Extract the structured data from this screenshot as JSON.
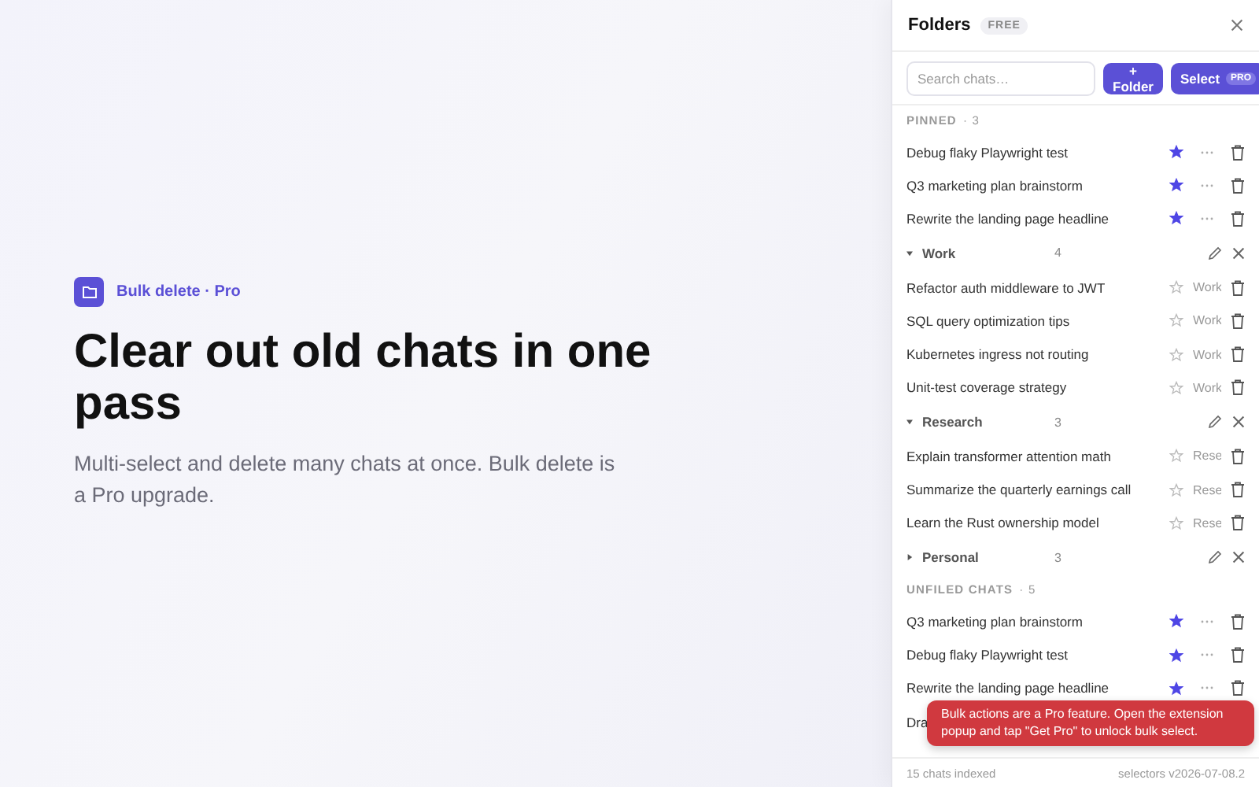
{
  "hero": {
    "badge": "Bulk delete · Pro",
    "title": "Clear out old chats in one pass",
    "subtitle": "Multi-select and delete many chats at once. Bulk delete is a Pro upgrade."
  },
  "panel": {
    "title": "Folders",
    "plan": "FREE",
    "search": {
      "placeholder": "Search chats…"
    },
    "folder_button": "+ Folder",
    "select_button": "Select",
    "select_badge": "PRO",
    "items": [
      {
        "kind": "section",
        "label": "PINNED",
        "count": "· 3"
      },
      {
        "kind": "chat",
        "title": "Debug flaky Playwright test",
        "starred": true
      },
      {
        "kind": "chat",
        "title": "Q3 marketing plan brainstorm",
        "starred": true
      },
      {
        "kind": "chat",
        "title": "Rewrite the landing page headline",
        "starred": true
      },
      {
        "kind": "folder",
        "name": "Work",
        "count": "4",
        "expanded": true
      },
      {
        "kind": "chat",
        "title": "Refactor auth middleware to JWT",
        "starred": false,
        "tag": "Work"
      },
      {
        "kind": "chat",
        "title": "SQL query optimization tips",
        "starred": false,
        "tag": "Work"
      },
      {
        "kind": "chat",
        "title": "Kubernetes ingress not routing",
        "starred": false,
        "tag": "Work"
      },
      {
        "kind": "chat",
        "title": "Unit-test coverage strategy",
        "starred": false,
        "tag": "Work"
      },
      {
        "kind": "folder",
        "name": "Research",
        "count": "3",
        "expanded": true
      },
      {
        "kind": "chat",
        "title": "Explain transformer attention math",
        "starred": false,
        "tag": "Rese"
      },
      {
        "kind": "chat",
        "title": "Summarize the quarterly earnings call",
        "starred": false,
        "tag": "Rese"
      },
      {
        "kind": "chat",
        "title": "Learn the Rust ownership model",
        "starred": false,
        "tag": "Rese"
      },
      {
        "kind": "folder",
        "name": "Personal",
        "count": "3",
        "expanded": false
      },
      {
        "kind": "section",
        "label": "UNFILED CHATS",
        "count": "· 5"
      },
      {
        "kind": "chat",
        "title": "Q3 marketing plan brainstorm",
        "starred": true
      },
      {
        "kind": "chat",
        "title": "Debug flaky Playwright test",
        "starred": true
      },
      {
        "kind": "chat",
        "title": "Rewrite the landing page headline",
        "starred": true
      },
      {
        "kind": "chat",
        "title": "Dra"
      }
    ],
    "toast": "Bulk actions are a Pro feature. Open the extension popup and tap \"Get Pro\" to unlock bulk select.",
    "footer": {
      "left": "15 chats indexed",
      "right": "selectors v2026-07-08.2"
    }
  }
}
